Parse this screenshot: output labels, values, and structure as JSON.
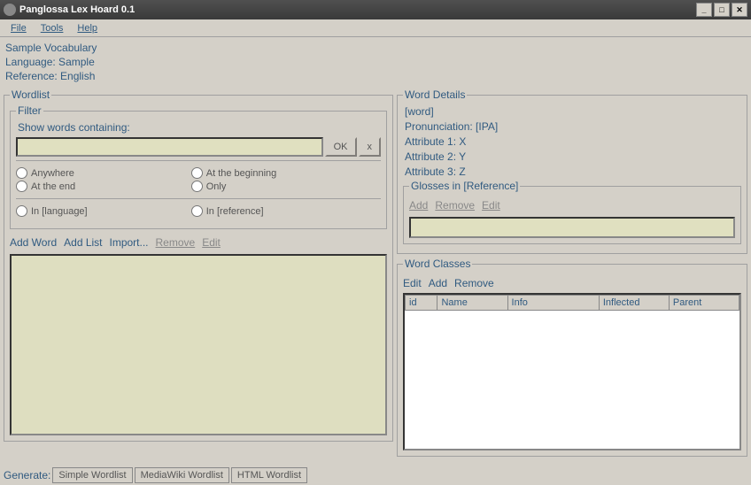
{
  "window": {
    "title": "Panglossa Lex Hoard 0.1"
  },
  "menu": {
    "file": "File",
    "tools": "Tools",
    "help": "Help"
  },
  "info": {
    "vocab": "Sample Vocabulary",
    "language": "Language: Sample",
    "reference": "Reference: English"
  },
  "wordlist": {
    "legend": "Wordlist",
    "filter_legend": "Filter",
    "show_label": "Show words containing:",
    "ok": "OK",
    "clear": "x",
    "radios": {
      "anywhere": "Anywhere",
      "beginning": "At the beginning",
      "end": "At the end",
      "only": "Only",
      "in_lang": "In [language]",
      "in_ref": "In [reference]"
    },
    "actions": {
      "add_word": "Add Word",
      "add_list": "Add List",
      "import": "Import...",
      "remove": "Remove",
      "edit": "Edit"
    }
  },
  "details": {
    "legend": "Word Details",
    "word": "[word]",
    "pron": "Pronunciation: [IPA]",
    "attr1": "Attribute 1: X",
    "attr2": "Attribute 2: Y",
    "attr3": "Attribute 3: Z"
  },
  "glosses": {
    "legend": "Glosses in [Reference]",
    "add": "Add",
    "remove": "Remove",
    "edit": "Edit"
  },
  "classes": {
    "legend": "Word Classes",
    "edit": "Edit",
    "add": "Add",
    "remove": "Remove",
    "cols": {
      "id": "id",
      "name": "Name",
      "info": "Info",
      "inflected": "Inflected",
      "parent": "Parent"
    }
  },
  "footer": {
    "label": "Generate:",
    "simple": "Simple Wordlist",
    "mediawiki": "MediaWiki Wordlist",
    "html": "HTML Wordlist"
  }
}
